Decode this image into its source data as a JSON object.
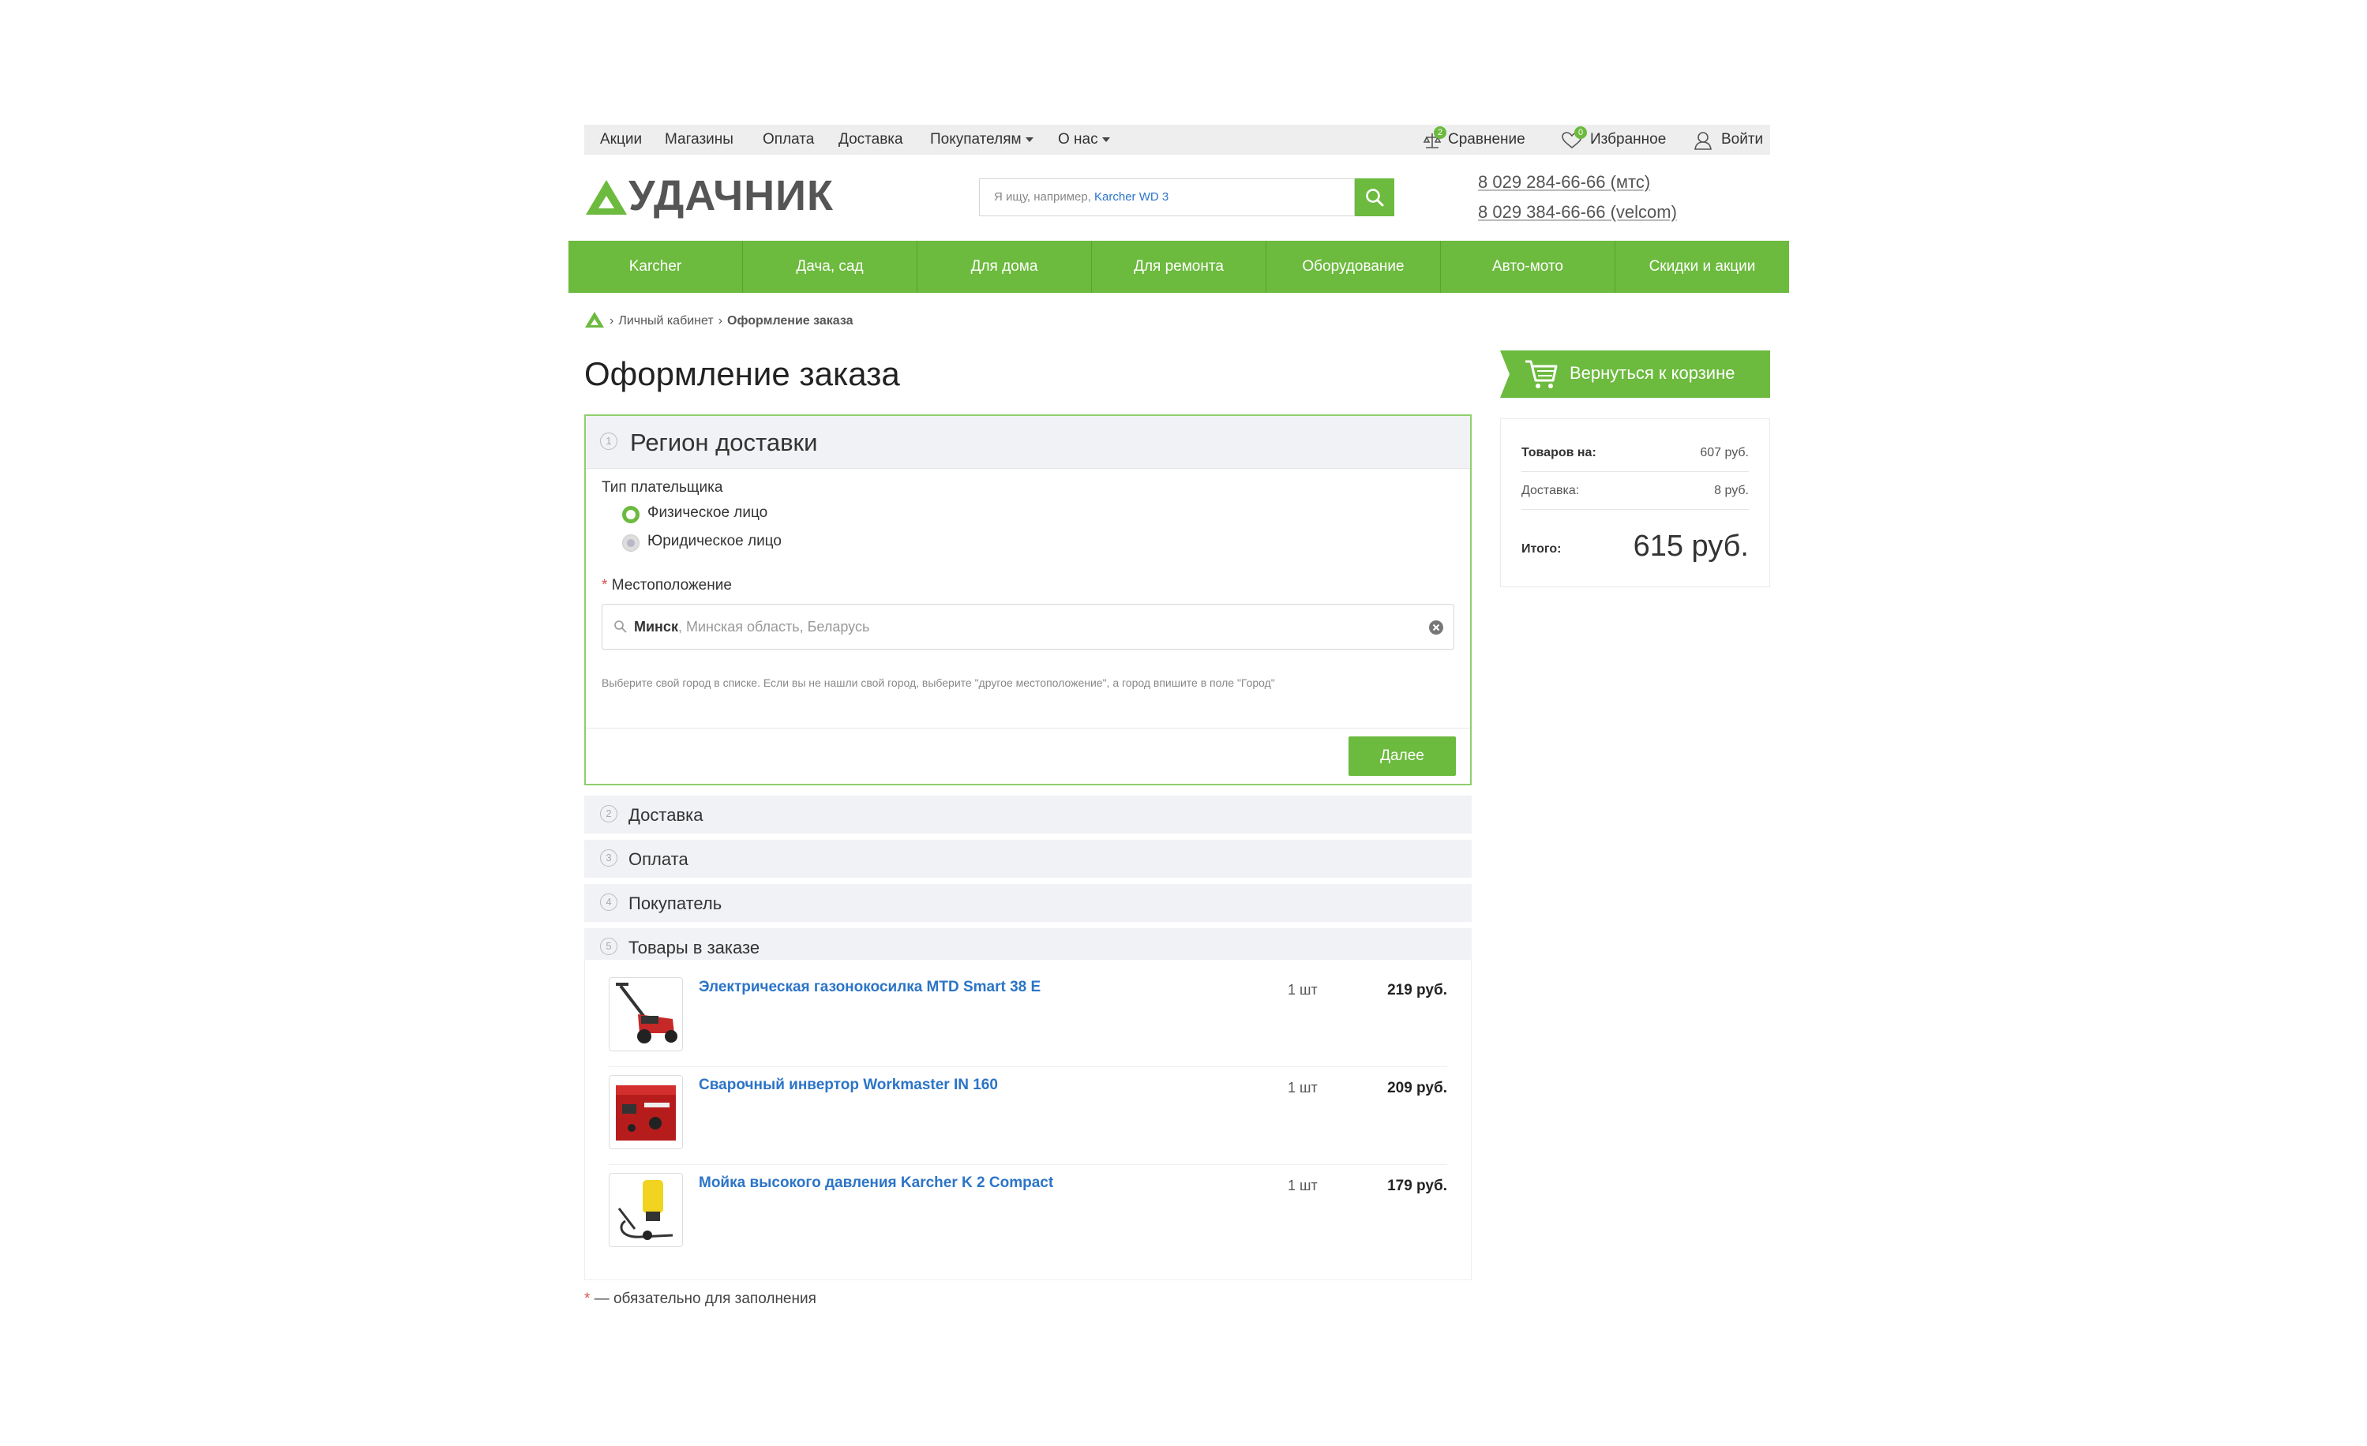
{
  "topbar": {
    "links": [
      "Акции",
      "Магазины",
      "Оплата",
      "Доставка",
      "Покупателям",
      "О нас"
    ],
    "compare_label": "Сравнение",
    "compare_count": "2",
    "favorites_label": "Избранное",
    "favorites_count": "0",
    "login_label": "Войти"
  },
  "header": {
    "logo_text": "УДАЧНИК",
    "search_placeholder_prefix": "Я ищу, например,",
    "search_placeholder_example": "Karcher WD 3",
    "phone_mts": "8 029 284-66-66 (мтс)",
    "phone_velcom": "8 029 384-66-66 (velcom)"
  },
  "nav": {
    "items": [
      "Karcher",
      "Дача, сад",
      "Для дома",
      "Для ремонта",
      "Оборудование",
      "Авто-мото",
      "Скидки и акции"
    ]
  },
  "breadcrumb": {
    "items": [
      "Личный кабинет",
      "Оформление заказа"
    ]
  },
  "page_title": "Оформление заказа",
  "region": {
    "step": "1",
    "title": "Регион доставки",
    "payer_type_label": "Тип плательщика",
    "payer_options": [
      "Физическое лицо",
      "Юридическое лицо"
    ],
    "payer_selected": "Физическое лицо",
    "location_label": "Местоположение",
    "location_city": "Минск",
    "location_rest": ", Минская область, Беларусь",
    "hint": "Выберите свой город в списке. Если вы не нашли свой город, выберите \"другое местоположение\", а город впишите в поле \"Город\"",
    "next_label": "Далее"
  },
  "steps": [
    {
      "num": "2",
      "label": "Доставка"
    },
    {
      "num": "3",
      "label": "Оплата"
    },
    {
      "num": "4",
      "label": "Покупатель"
    },
    {
      "num": "5",
      "label": "Товары в заказе"
    }
  ],
  "order_items": [
    {
      "name": "Электрическая газонокосилка MTD Smart 38 E",
      "qty": "1 шт",
      "price": "219 руб."
    },
    {
      "name": "Сварочный инвертор Workmaster IN 160",
      "qty": "1 шт",
      "price": "209 руб."
    },
    {
      "name": "Мойка высокого давления Karcher K 2 Compact",
      "qty": "1 шт",
      "price": "179 руб."
    }
  ],
  "required_note": "— обязательно для заполнения",
  "sidebar": {
    "back_label": "Вернуться к корзине",
    "goods_label": "Товаров на:",
    "goods_value": "607 руб.",
    "delivery_label": "Доставка:",
    "delivery_value": "8 руб.",
    "total_label": "Итого:",
    "total_value": "615 руб."
  },
  "colors": {
    "brand_green": "#6cba3e",
    "link_blue": "#2b74c7",
    "required_red": "#d9534f"
  }
}
